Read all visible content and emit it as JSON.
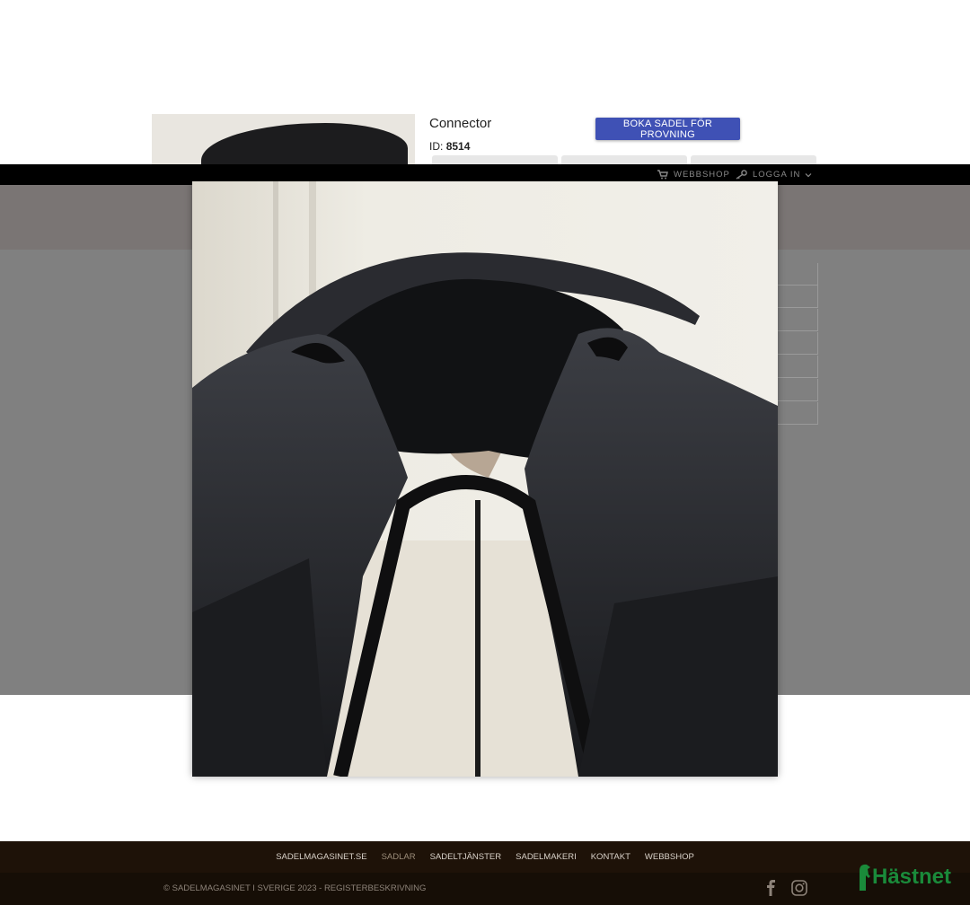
{
  "product": {
    "title": "Connector",
    "id_label": "ID:",
    "id_value": "8514",
    "book_button": "BOKA SADEL FÖR PROVNING"
  },
  "topbar": {
    "webshop": "WEBBSHOP",
    "login": "LOGGA IN"
  },
  "footer": {
    "nav": [
      "SADELMAGASINET.SE",
      "SADLAR",
      "SADELTJÄNSTER",
      "SADELMAKERI",
      "KONTAKT",
      "WEBBSHOP"
    ],
    "active_nav": "SADLAR",
    "copyright": "© SADELMAGASINET I SVERIGE 2023 - REGISTERBESKRIVNING",
    "partner_logo": "Hästnet"
  },
  "icons": [
    "cart-icon",
    "key-icon",
    "chevron-down-icon",
    "facebook-icon",
    "instagram-icon"
  ],
  "colors": {
    "accent_button": "#3f51b5",
    "footer_bg": "#1e1208",
    "partner_green": "#1a8a3a"
  }
}
